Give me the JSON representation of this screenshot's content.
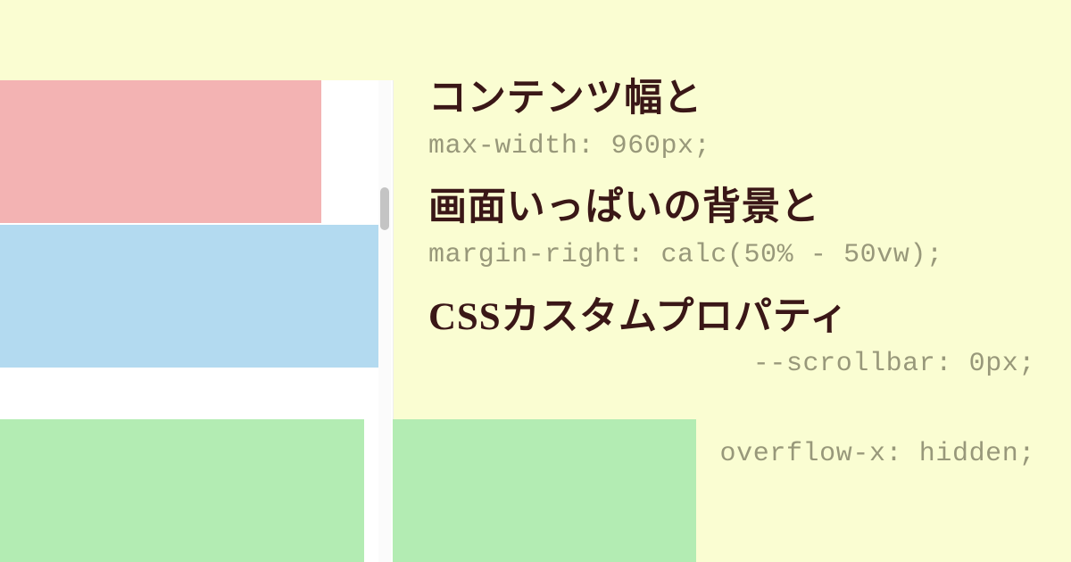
{
  "headings": {
    "line1": "コンテンツ幅と",
    "line2": "画面いっぱいの背景と",
    "line3": "CSSカスタムプロパティ"
  },
  "code": {
    "snippet1": "max-width: 960px;",
    "snippet2": "margin-right: calc(50% - 50vw);",
    "snippet3": "--scrollbar: 0px;",
    "snippet4": "overflow-x: hidden;"
  },
  "colors": {
    "background": "#fafdd2",
    "heading": "#3a1717",
    "code": "#98987a",
    "block_red": "#f3b3b3",
    "block_blue": "#b3daf0",
    "block_green": "#b3ecb3",
    "scrollbar_thumb": "#c4c4c4"
  }
}
